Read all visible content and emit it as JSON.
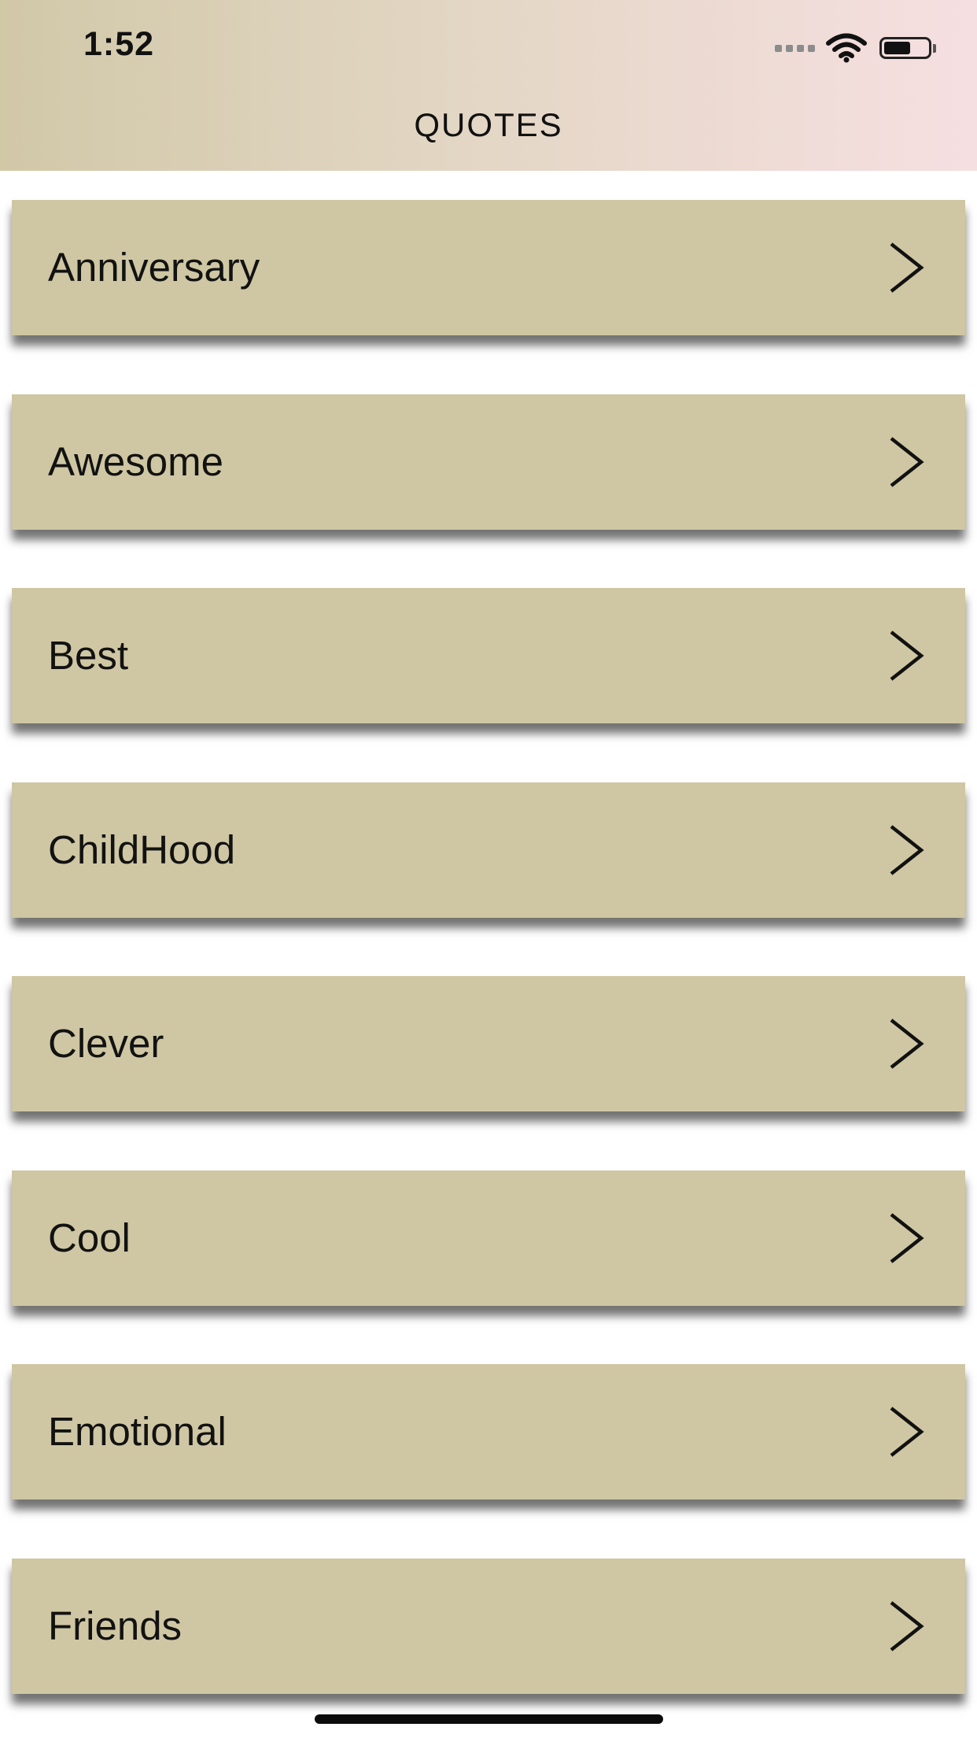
{
  "status_bar": {
    "time": "1:52",
    "battery_level": 0.65,
    "icons": [
      "cellular-signal-icon",
      "wifi-icon",
      "battery-icon"
    ]
  },
  "nav": {
    "title": "QUOTES"
  },
  "colors": {
    "header_gradient_start": "#d1c8a8",
    "header_gradient_end": "#f6dfe1",
    "row_background": "#cfc7a3",
    "text": "#111111"
  },
  "categories": [
    {
      "label": "Anniversary",
      "icon": "chevron-right-icon"
    },
    {
      "label": "Awesome",
      "icon": "chevron-right-icon"
    },
    {
      "label": "Best",
      "icon": "chevron-right-icon"
    },
    {
      "label": "ChildHood",
      "icon": "chevron-right-icon"
    },
    {
      "label": "Clever",
      "icon": "chevron-right-icon"
    },
    {
      "label": "Cool",
      "icon": "chevron-right-icon"
    },
    {
      "label": "Emotional",
      "icon": "chevron-right-icon"
    },
    {
      "label": "Friends",
      "icon": "chevron-right-icon"
    }
  ]
}
